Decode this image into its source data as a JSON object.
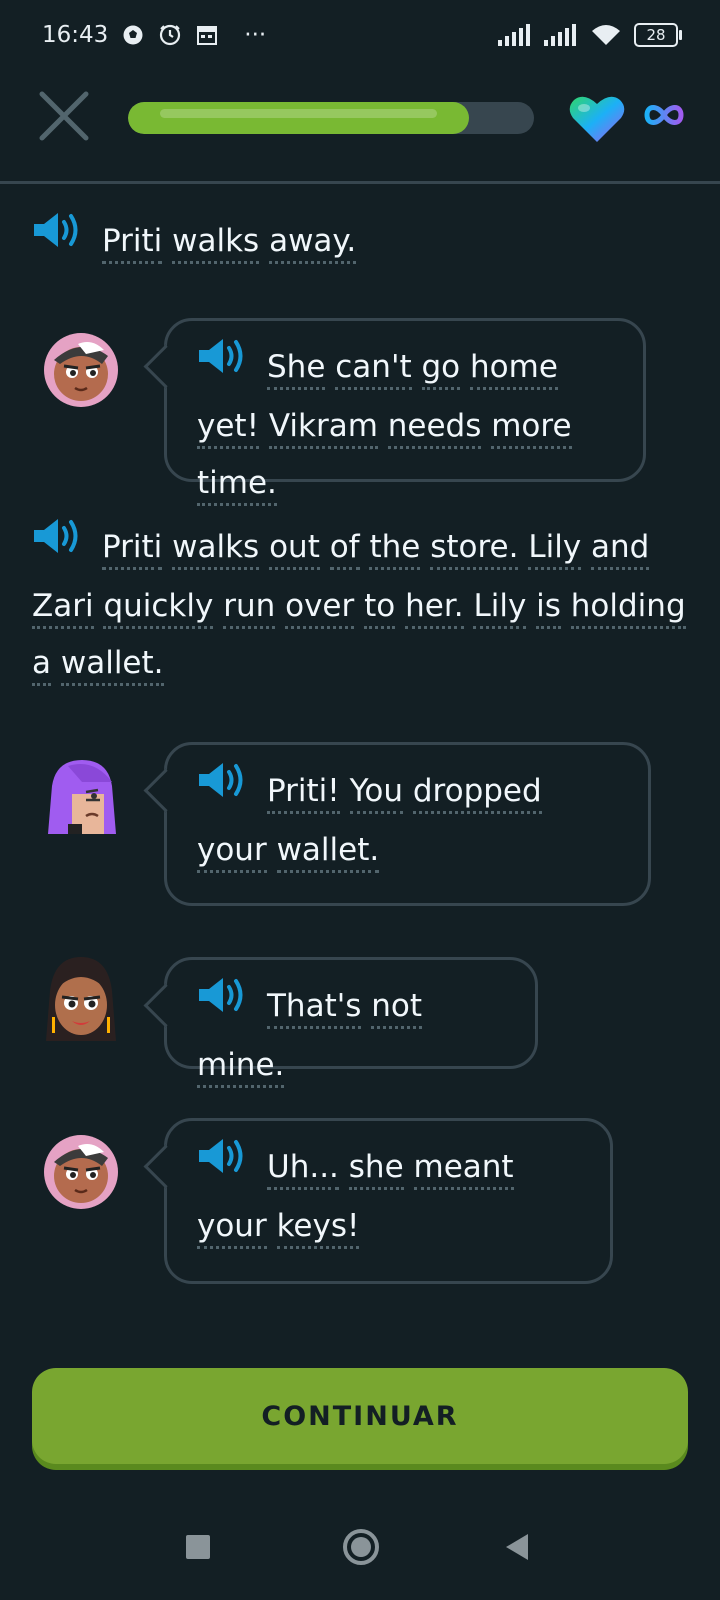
{
  "status_bar": {
    "time": "16:43",
    "more": "···",
    "battery": "28",
    "icons": [
      "soccer-ball-icon",
      "alarm-icon",
      "calendar-icon",
      "signal-icon",
      "signal-icon",
      "wifi-icon",
      "battery-icon"
    ]
  },
  "lesson": {
    "progress": 0.84,
    "progress_color": "#79b933",
    "hearts_icon": "heart-gradient-icon",
    "hearts_label": "∞"
  },
  "dialogue": {
    "narration_1": [
      "Priti",
      "walks",
      "away."
    ],
    "line_1": [
      "She",
      "can't",
      "go",
      "home",
      "yet!",
      "Vikram",
      "needs",
      "more",
      "time."
    ],
    "narration_2": [
      "Priti",
      "walks",
      "out",
      "of",
      "the",
      "store.",
      "Lily",
      "and",
      "Zari",
      "quickly",
      "run",
      "over",
      "to",
      "her.",
      "Lily",
      "is",
      "holding",
      "a",
      "wallet."
    ],
    "line_2": [
      "Priti!",
      "You",
      "dropped",
      "your",
      "wallet."
    ],
    "line_3": [
      "That's",
      "not",
      "mine."
    ],
    "line_4": [
      "Uh...",
      "she",
      "meant",
      "your",
      "keys!"
    ]
  },
  "footer": {
    "continue_label": "CONTINUAR",
    "accent": "#79a630"
  }
}
